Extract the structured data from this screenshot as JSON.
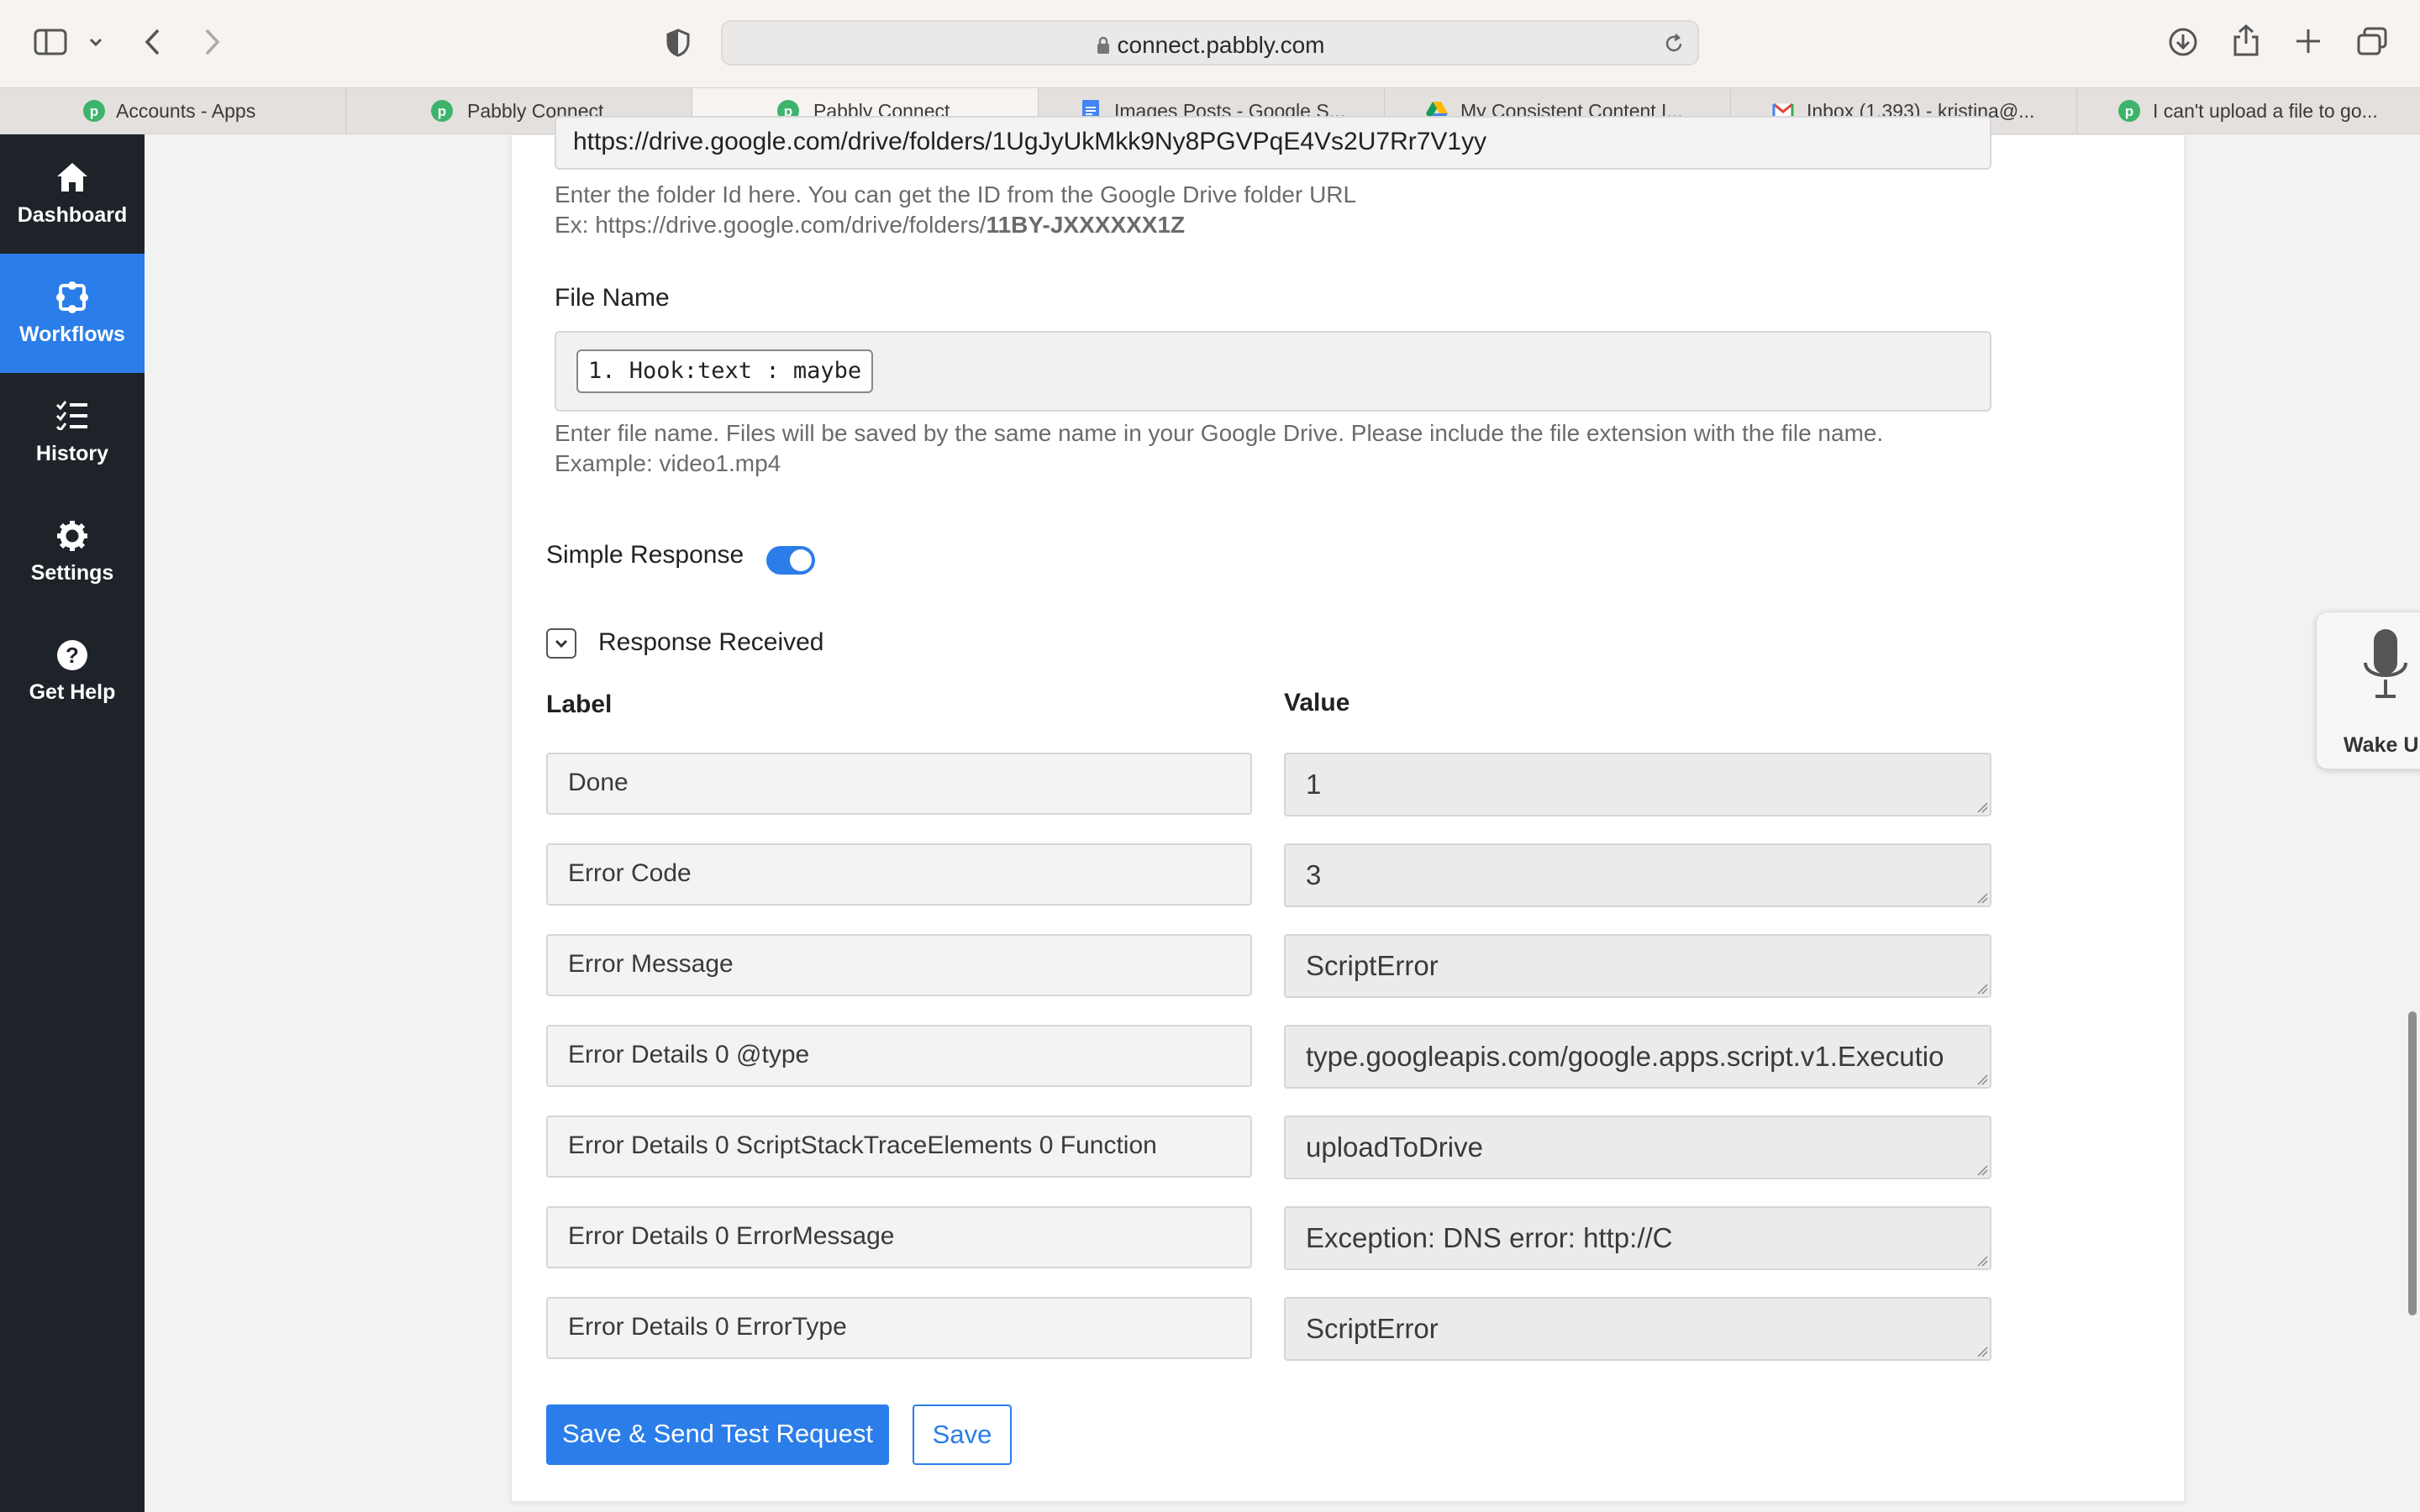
{
  "browser": {
    "url": "connect.pabbly.com",
    "tabs": [
      {
        "title": "Accounts - Apps",
        "icon": "pabbly-icon",
        "active": false
      },
      {
        "title": "Pabbly Connect",
        "icon": "pabbly-icon",
        "active": false
      },
      {
        "title": "Pabbly Connect",
        "icon": "pabbly-icon",
        "active": true
      },
      {
        "title": "Images Posts - Google S...",
        "icon": "google-docs-icon",
        "active": false
      },
      {
        "title": "My Consistent Content I...",
        "icon": "google-drive-icon",
        "active": false
      },
      {
        "title": "Inbox (1,393) - kristina@...",
        "icon": "gmail-icon",
        "active": false
      },
      {
        "title": "I can't upload a file to go...",
        "icon": "pabbly-icon",
        "active": false
      }
    ]
  },
  "sidebar": {
    "items": [
      {
        "label": "Dashboard",
        "icon": "home-icon",
        "active": false
      },
      {
        "label": "Workflows",
        "icon": "workflow-icon",
        "active": true
      },
      {
        "label": "History",
        "icon": "list-check-icon",
        "active": false
      },
      {
        "label": "Settings",
        "icon": "gear-icon",
        "active": false
      },
      {
        "label": "Get Help",
        "icon": "help-circle-icon",
        "active": false
      }
    ]
  },
  "form": {
    "folder_url_value": "https://drive.google.com/drive/folders/1UgJyUkMkk9Ny8PGVPqE4Vs2U7Rr7V1yy",
    "folder_hint_line1": "Enter the folder Id here. You can get the ID from the Google Drive folder URL",
    "folder_hint_prefix": "Ex: https://drive.google.com/drive/folders/",
    "folder_hint_bold": "11BY-JXXXXXX1Z",
    "file_name_label": "File Name",
    "file_name_chip": "1. Hook:text : maybe",
    "file_name_hint_line1": "Enter file name. Files will be saved by the same name in your Google Drive. Please include the file extension with the file name.",
    "file_name_hint_line2": "Example: video1.mp4",
    "simple_response_label": "Simple Response",
    "simple_response_on": true,
    "response_received_label": "Response Received",
    "label_header": "Label",
    "value_header": "Value",
    "rows": [
      {
        "label": "Done",
        "value": "1"
      },
      {
        "label": "Error Code",
        "value": "3"
      },
      {
        "label": "Error Message",
        "value": "ScriptError"
      },
      {
        "label": "Error Details 0 @type",
        "value": "type.googleapis.com/google.apps.script.v1.Executio"
      },
      {
        "label": "Error Details 0 ScriptStackTraceElements 0 Function",
        "value": "uploadToDrive"
      },
      {
        "label": "Error Details 0 ErrorMessage",
        "value": "Exception: DNS error: http://C"
      },
      {
        "label": "Error Details 0 ErrorType",
        "value": "ScriptError"
      }
    ],
    "save_send_label": "Save & Send Test Request",
    "save_label": "Save"
  },
  "widget": {
    "wake_label": "Wake Up"
  },
  "colors": {
    "accent": "#2b7de9",
    "sidebar_bg": "#1e2329"
  }
}
